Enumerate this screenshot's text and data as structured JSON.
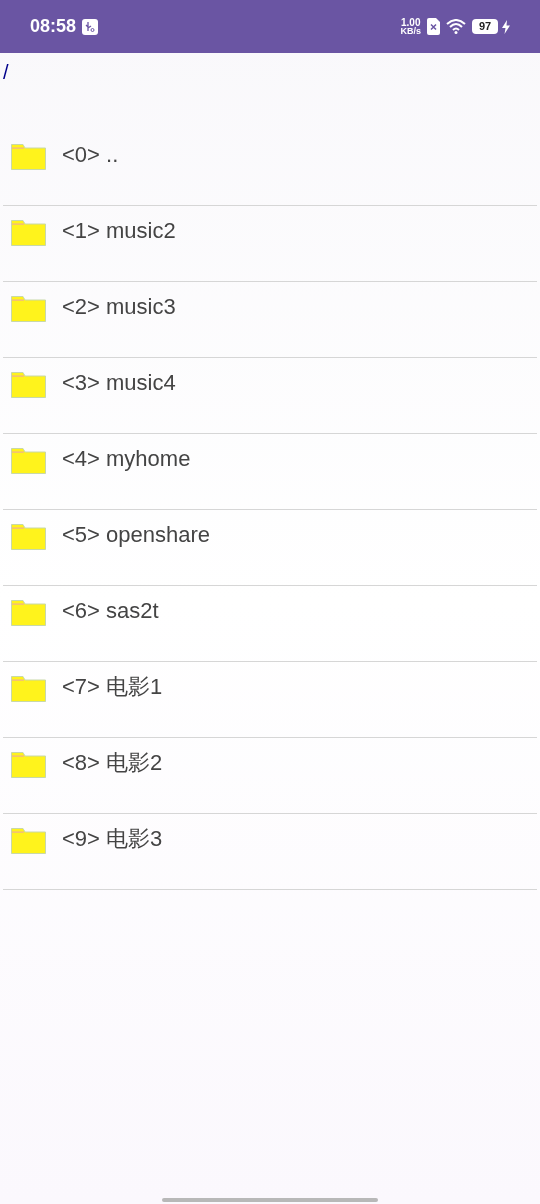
{
  "status_bar": {
    "time": "08:58",
    "speed_value": "1.00",
    "speed_unit": "KB/s",
    "battery": "97"
  },
  "path": "/",
  "items": [
    {
      "label": "<0> .."
    },
    {
      "label": "<1> music2"
    },
    {
      "label": "<2> music3"
    },
    {
      "label": "<3> music4"
    },
    {
      "label": "<4> myhome"
    },
    {
      "label": "<5> openshare"
    },
    {
      "label": "<6> sas2t"
    },
    {
      "label": "<7> 电影1"
    },
    {
      "label": "<8> 电影2"
    },
    {
      "label": "<9> 电影3"
    }
  ]
}
